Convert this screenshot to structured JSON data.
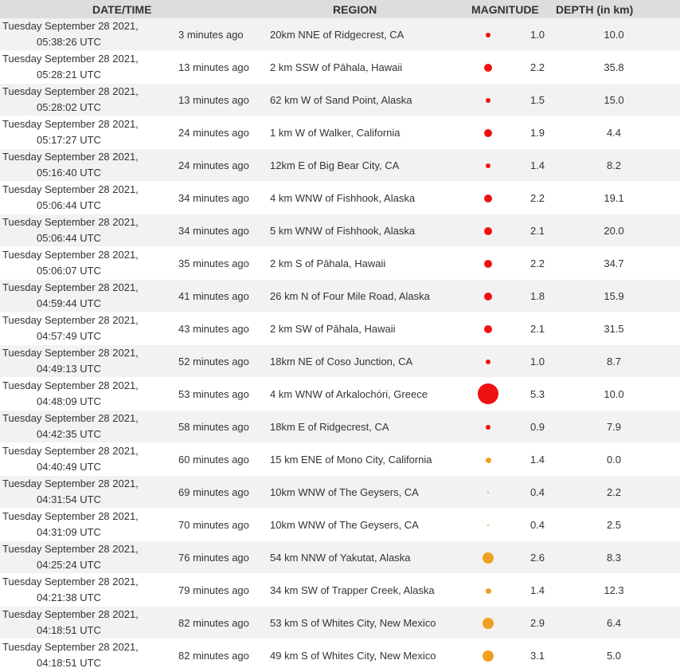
{
  "headers": {
    "datetime": "DATE/TIME",
    "region": "REGION",
    "magnitude": "MAGNITUDE",
    "depth": "DEPTH (in km)"
  },
  "colors": {
    "red": "#ee1111",
    "orange": "#f0a020"
  },
  "rows": [
    {
      "date": "Tuesday September 28 2021,",
      "time": "05:38:26 UTC",
      "ago": "3 minutes ago",
      "region": "20km NNE of Ridgecrest, CA",
      "mag": "1.0",
      "depth": "10.0",
      "dot_color": "red"
    },
    {
      "date": "Tuesday September 28 2021,",
      "time": "05:28:21 UTC",
      "ago": "13 minutes ago",
      "region": "2 km SSW of Pāhala, Hawaii",
      "mag": "2.2",
      "depth": "35.8",
      "dot_color": "red"
    },
    {
      "date": "Tuesday September 28 2021,",
      "time": "05:28:02 UTC",
      "ago": "13 minutes ago",
      "region": "62 km W of Sand Point, Alaska",
      "mag": "1.5",
      "depth": "15.0",
      "dot_color": "red"
    },
    {
      "date": "Tuesday September 28 2021,",
      "time": "05:17:27 UTC",
      "ago": "24 minutes ago",
      "region": "1 km W of Walker, California",
      "mag": "1.9",
      "depth": "4.4",
      "dot_color": "red"
    },
    {
      "date": "Tuesday September 28 2021,",
      "time": "05:16:40 UTC",
      "ago": "24 minutes ago",
      "region": "12km E of Big Bear City, CA",
      "mag": "1.4",
      "depth": "8.2",
      "dot_color": "red"
    },
    {
      "date": "Tuesday September 28 2021,",
      "time": "05:06:44 UTC",
      "ago": "34 minutes ago",
      "region": "4 km WNW of Fishhook, Alaska",
      "mag": "2.2",
      "depth": "19.1",
      "dot_color": "red"
    },
    {
      "date": "Tuesday September 28 2021,",
      "time": "05:06:44 UTC",
      "ago": "34 minutes ago",
      "region": "5 km WNW of Fishhook, Alaska",
      "mag": "2.1",
      "depth": "20.0",
      "dot_color": "red"
    },
    {
      "date": "Tuesday September 28 2021,",
      "time": "05:06:07 UTC",
      "ago": "35 minutes ago",
      "region": "2 km S of Pāhala, Hawaii",
      "mag": "2.2",
      "depth": "34.7",
      "dot_color": "red"
    },
    {
      "date": "Tuesday September 28 2021,",
      "time": "04:59:44 UTC",
      "ago": "41 minutes ago",
      "region": "26 km N of Four Mile Road, Alaska",
      "mag": "1.8",
      "depth": "15.9",
      "dot_color": "red"
    },
    {
      "date": "Tuesday September 28 2021,",
      "time": "04:57:49 UTC",
      "ago": "43 minutes ago",
      "region": "2 km SW of Pāhala, Hawaii",
      "mag": "2.1",
      "depth": "31.5",
      "dot_color": "red"
    },
    {
      "date": "Tuesday September 28 2021,",
      "time": "04:49:13 UTC",
      "ago": "52 minutes ago",
      "region": "18km NE of Coso Junction, CA",
      "mag": "1.0",
      "depth": "8.7",
      "dot_color": "red"
    },
    {
      "date": "Tuesday September 28 2021,",
      "time": "04:48:09 UTC",
      "ago": "53 minutes ago",
      "region": "4 km WNW of Arkalochóri, Greece",
      "mag": "5.3",
      "depth": "10.0",
      "dot_color": "red"
    },
    {
      "date": "Tuesday September 28 2021,",
      "time": "04:42:35 UTC",
      "ago": "58 minutes ago",
      "region": "18km E of Ridgecrest, CA",
      "mag": "0.9",
      "depth": "7.9",
      "dot_color": "red"
    },
    {
      "date": "Tuesday September 28 2021,",
      "time": "04:40:49 UTC",
      "ago": "60 minutes ago",
      "region": "15 km ENE of Mono City, California",
      "mag": "1.4",
      "depth": "0.0",
      "dot_color": "orange"
    },
    {
      "date": "Tuesday September 28 2021,",
      "time": "04:31:54 UTC",
      "ago": "69 minutes ago",
      "region": "10km WNW of The Geysers, CA",
      "mag": "0.4",
      "depth": "2.2",
      "dot_color": "orange"
    },
    {
      "date": "Tuesday September 28 2021,",
      "time": "04:31:09 UTC",
      "ago": "70 minutes ago",
      "region": "10km WNW of The Geysers, CA",
      "mag": "0.4",
      "depth": "2.5",
      "dot_color": "orange"
    },
    {
      "date": "Tuesday September 28 2021,",
      "time": "04:25:24 UTC",
      "ago": "76 minutes ago",
      "region": "54 km NNW of Yakutat, Alaska",
      "mag": "2.6",
      "depth": "8.3",
      "dot_color": "orange"
    },
    {
      "date": "Tuesday September 28 2021,",
      "time": "04:21:38 UTC",
      "ago": "79 minutes ago",
      "region": "34 km SW of Trapper Creek, Alaska",
      "mag": "1.4",
      "depth": "12.3",
      "dot_color": "orange"
    },
    {
      "date": "Tuesday September 28 2021,",
      "time": "04:18:51 UTC",
      "ago": "82 minutes ago",
      "region": "53 km S of Whites City, New Mexico",
      "mag": "2.9",
      "depth": "6.4",
      "dot_color": "orange"
    },
    {
      "date": "Tuesday September 28 2021,",
      "time": "04:18:51 UTC",
      "ago": "82 minutes ago",
      "region": "49 km S of Whites City, New Mexico",
      "mag": "3.1",
      "depth": "5.0",
      "dot_color": "orange"
    }
  ]
}
